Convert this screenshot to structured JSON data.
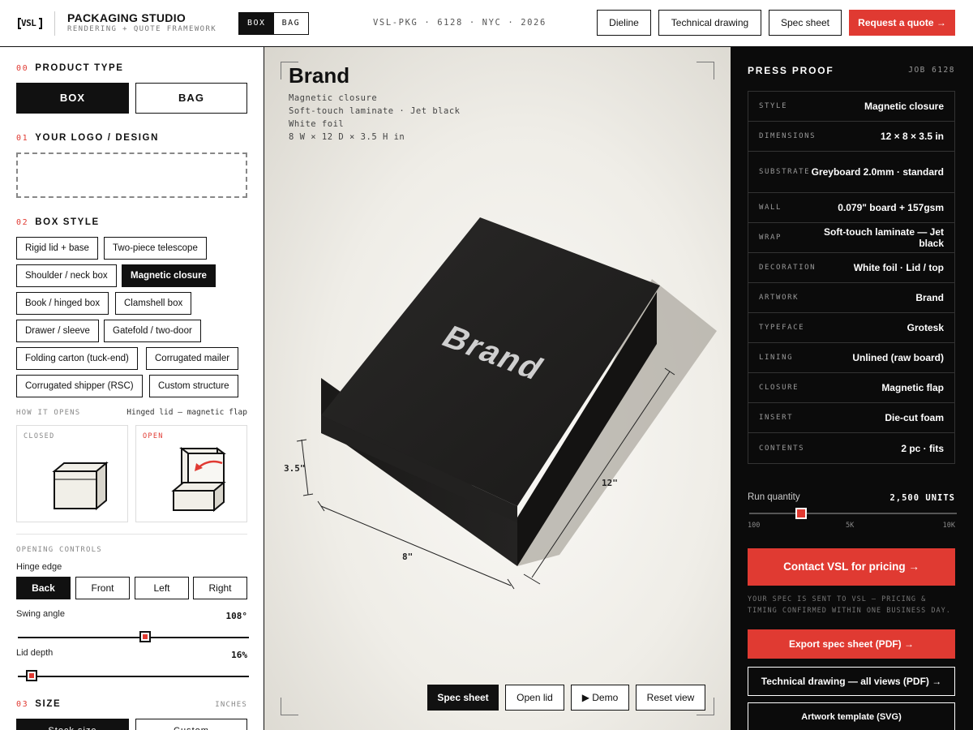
{
  "header": {
    "logo_text": "VSL",
    "title": "PACKAGING STUDIO",
    "subtitle": "RENDERING + QUOTE FRAMEWORK",
    "mode_tabs": [
      {
        "label": "BOX",
        "selected": true
      },
      {
        "label": "BAG",
        "selected": false
      }
    ],
    "job_code": "VSL-PKG · 6128 · NYC · 2026",
    "buttons": [
      "Dieline",
      "Technical drawing",
      "Spec sheet"
    ],
    "quote_button": "Request a quote →"
  },
  "left": {
    "product_type": {
      "num": "00",
      "title": "PRODUCT TYPE",
      "options": [
        "BOX",
        "BAG"
      ],
      "selected": "BOX"
    },
    "logo": {
      "num": "01",
      "title": "YOUR LOGO / DESIGN"
    },
    "box_style": {
      "num": "02",
      "title": "BOX STYLE",
      "options": [
        "Rigid lid + base",
        "Two-piece telescope",
        "Shoulder / neck box",
        "Magnetic closure",
        "Book / hinged box",
        "Clamshell box",
        "Drawer / sleeve",
        "Gatefold / two-door",
        "Folding carton (tuck-end)",
        "Corrugated mailer",
        "Corrugated shipper (RSC)",
        "Custom structure"
      ],
      "selected": "Magnetic closure"
    },
    "how_it_opens": {
      "label": "HOW IT OPENS",
      "value": "Hinged lid — magnetic flap",
      "closed_label": "CLOSED",
      "open_label": "OPEN"
    },
    "opening_controls": {
      "label": "OPENING CONTROLS",
      "hinge_label": "Hinge edge",
      "hinge_options": [
        "Back",
        "Front",
        "Left",
        "Right"
      ],
      "hinge_selected": "Back",
      "swing_label": "Swing angle",
      "swing_value": "108°",
      "swing_fraction": 0.55,
      "depth_label": "Lid depth",
      "depth_value": "16%",
      "depth_fraction": 0.06
    },
    "size": {
      "num": "03",
      "title": "SIZE",
      "unit": "INCHES",
      "options": [
        "Stock size",
        "Custom"
      ]
    }
  },
  "preview": {
    "title": "Brand",
    "lines": [
      "Magnetic closure",
      "Soft-touch laminate · Jet black",
      "White foil",
      "8 W × 12 D × 3.5 H in"
    ],
    "box_text": "Brand",
    "dim_height": "3.5\"",
    "dim_width": "8\"",
    "dim_depth": "12\"",
    "buttons": [
      "Spec sheet",
      "Open lid",
      "▶ Demo",
      "Reset view"
    ],
    "colors": {
      "box": "#1c1b1a",
      "foil": "#cfcfcf"
    }
  },
  "proof": {
    "title": "PRESS PROOF",
    "job": "JOB 6128",
    "rows": [
      {
        "k": "STYLE",
        "v": "Magnetic closure"
      },
      {
        "k": "DIMENSIONS",
        "v": "12 × 8 × 3.5 in"
      },
      {
        "k": "SUBSTRATE",
        "v": "Greyboard 2.0mm · standard"
      },
      {
        "k": "WALL",
        "v": "0.079\" board + 157gsm"
      },
      {
        "k": "WRAP",
        "v": "Soft-touch laminate — Jet black"
      },
      {
        "k": "DECORATION",
        "v": "White foil · Lid / top"
      },
      {
        "k": "ARTWORK",
        "v": "Brand"
      },
      {
        "k": "TYPEFACE",
        "v": "Grotesk"
      },
      {
        "k": "LINING",
        "v": "Unlined (raw board)"
      },
      {
        "k": "CLOSURE",
        "v": "Magnetic flap"
      },
      {
        "k": "INSERT",
        "v": "Die-cut foam"
      },
      {
        "k": "CONTENTS",
        "v": "2 pc · fits"
      }
    ],
    "run_label": "Run quantity",
    "run_value": "2,500 UNITS",
    "run_fraction": 0.25,
    "ticks": [
      "100",
      "5K",
      "10K"
    ],
    "contact_button": "Contact VSL for pricing →",
    "note": "YOUR SPEC IS SENT TO VSL — PRICING & TIMING CONFIRMED WITHIN ONE BUSINESS DAY.",
    "export_button": "Export spec sheet (PDF) →",
    "drawing_button": "Technical drawing — all views (PDF) →",
    "artwork_button": "Artwork template (SVG)"
  },
  "colors": {
    "accent": "#e03a32",
    "ink": "#111111",
    "panel_dark": "#0b0b0b"
  }
}
